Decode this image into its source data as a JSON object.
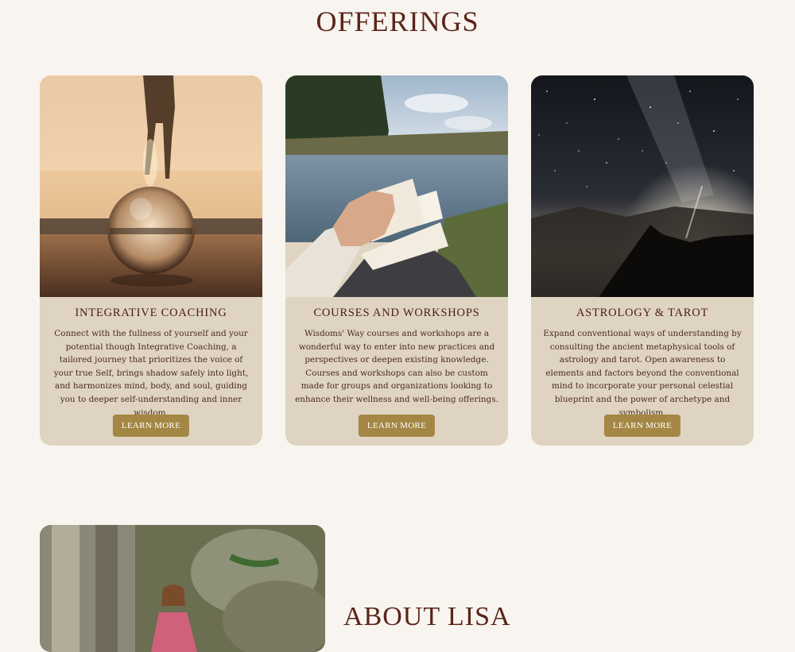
{
  "offerings": {
    "title": "OFFERINGS",
    "cards": [
      {
        "image": "crystal-ball-sunset-image",
        "title": "INTEGRATIVE COACHING",
        "description": "Connect with the fullness of yourself and your potential though Integrative Coaching, a tailored journey that prioritizes the voice of your true Self, brings shadow safely into light, and harmonizes mind, body, and soul, guiding you to deeper self-understanding and inner wisdom.",
        "button": "LEARN MORE"
      },
      {
        "image": "journal-by-lake-image",
        "title": "COURSES AND WORKSHOPS",
        "description": "Wisdoms' Way courses and workshops are a wonderful way to enter into new practices and perspectives or deepen existing knowledge. Courses and workshops can also be custom made for groups and organizations looking to enhance their wellness and well-being offerings.",
        "button": "LEARN MORE"
      },
      {
        "image": "milky-way-mountain-image",
        "title": "ASTROLOGY & TAROT",
        "description": "Expand conventional ways of understanding by consulting the ancient metaphysical tools of astrology and tarot. Open awareness to elements and factors beyond the conventional mind to incorporate your personal celestial blueprint and the power of archetype and symbolism.",
        "button": "LEARN MORE"
      }
    ]
  },
  "about": {
    "title": "ABOUT LISA",
    "image": "lisa-in-forest-image"
  },
  "colors": {
    "background": "#f8f4ef",
    "card": "#dfd4c1",
    "button": "#a48744",
    "heading": "#5a2418"
  }
}
